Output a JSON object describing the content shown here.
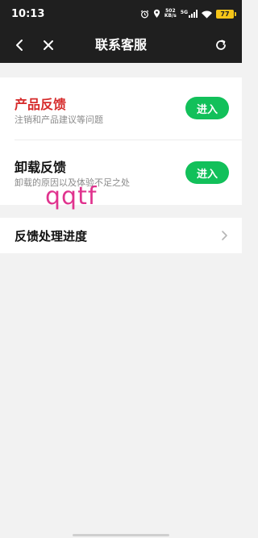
{
  "status_bar": {
    "time": "10:13",
    "net_speed_value": "502",
    "net_speed_unit": "KB/s",
    "network": "5G",
    "battery": "77"
  },
  "nav": {
    "title": "联系客服"
  },
  "items": [
    {
      "title": "产品反馈",
      "subtitle": "注销和产品建议等问题",
      "button": "进入",
      "title_color": "#d62b2b"
    },
    {
      "title": "卸载反馈",
      "subtitle": "卸载的原因以及体验不足之处",
      "button": "进入",
      "title_color": "#111111"
    }
  ],
  "watermark": "qqtf",
  "progress": {
    "label": "反馈处理进度"
  },
  "colors": {
    "accent_green": "#12c05a",
    "header_bg": "#1f1f1f",
    "watermark": "#e0338e"
  }
}
